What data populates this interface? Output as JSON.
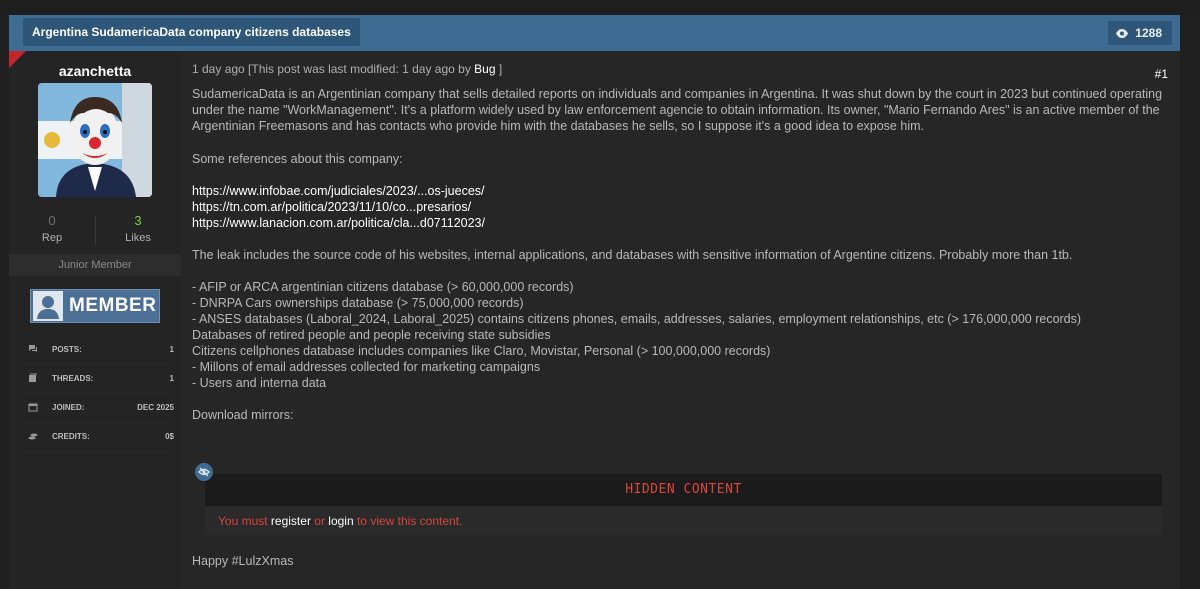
{
  "thread": {
    "title": "Argentina SudamericaData company citizens databases",
    "views": "1288"
  },
  "user": {
    "username": "azanchetta",
    "rep_value": "0",
    "rep_label": "Rep",
    "likes_value": "3",
    "likes_label": "Likes",
    "rank": "Junior Member",
    "badge_text": "MEMBER",
    "info": [
      {
        "icon": "comments-icon",
        "key": "POSTS:",
        "value": "1"
      },
      {
        "icon": "threads-icon",
        "key": "THREADS:",
        "value": "1"
      },
      {
        "icon": "calendar-icon",
        "key": "JOINED:",
        "value": "DEC 2025"
      },
      {
        "icon": "credits-icon",
        "key": "CREDITS:",
        "value": "0$"
      }
    ]
  },
  "post": {
    "meta_prefix": "1 day ago [This post was last modified: 1 day ago by ",
    "meta_author": "Bug",
    "meta_suffix": " ]",
    "number": "#1",
    "intro": "SudamericaData is an Argentinian company that sells detailed reports on individuals and companies in Argentina. It was shut down by the court in 2023 but continued operating under the name \"WorkManagement\". It's a platform widely used by law enforcement agencie to obtain information. Its owner, \"Mario Fernando Ares\" is an active member of the Argentinian Freemasons and has contacts who provide him with the databases he sells, so I suppose it's a good idea to expose him.",
    "references_heading": "Some references about this company:",
    "links": [
      "https://www.infobae.com/judiciales/2023/...os-jueces/",
      "https://tn.com.ar/politica/2023/11/10/co...presarios/",
      "https://www.lanacion.com.ar/politica/cla...d07112023/"
    ],
    "leak_summary": "The leak includes the source code of his websites, internal applications, and databases with sensitive information of Argentine citizens. Probably more than 1tb.",
    "items": [
      "- AFIP or ARCA argentinian citizens database (> 60,000,000 records)",
      "- DNRPA Cars ownerships database (> 75,000,000 records)",
      "- ANSES databases (Laboral_2024, Laboral_2025) contains citizens phones, emails, addresses, salaries, employment relationships, etc (> 176,000,000 records)",
      "Databases of retired people and people receiving state subsidies",
      "Citizens cellphones database includes companies like Claro, Movistar, Personal (> 100,000,000 records)",
      "- Millons of email addresses collected for marketing campaigns",
      "- Users and interna data"
    ],
    "download_heading": "Download mirrors:",
    "hidden_title": "HIDDEN CONTENT",
    "hidden_msg_1": "You must ",
    "hidden_register": "register",
    "hidden_msg_2": " or ",
    "hidden_login": "login",
    "hidden_msg_3": " to view this content.",
    "signoff": "Happy #LulzXmas"
  },
  "colors": {
    "header_bg": "#3e6b91",
    "accent_red": "#d8463d",
    "badge_bg": "#4b6f95"
  }
}
